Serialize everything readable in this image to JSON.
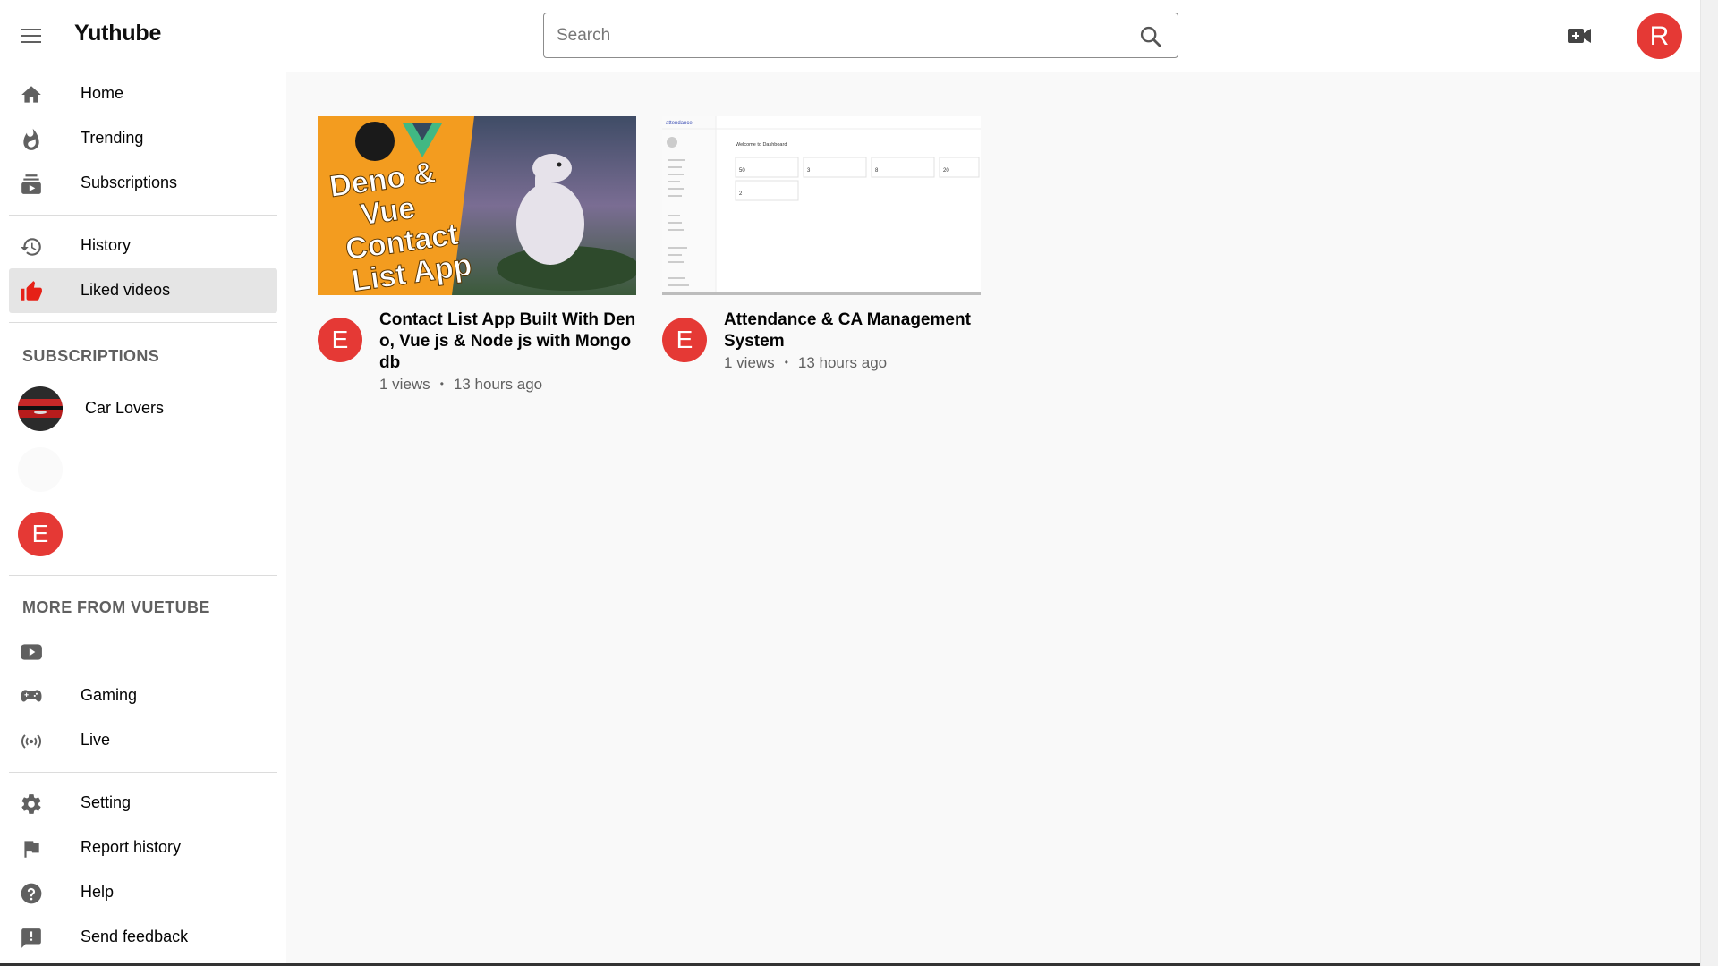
{
  "header": {
    "logo": "Yuthube",
    "search_placeholder": "Search",
    "avatar_letter": "R"
  },
  "sidebar": {
    "main": [
      {
        "label": "Home",
        "icon": "home-icon"
      },
      {
        "label": "Trending",
        "icon": "fire-icon"
      },
      {
        "label": "Subscriptions",
        "icon": "subscriptions-icon"
      }
    ],
    "library": [
      {
        "label": "History",
        "icon": "history-icon"
      },
      {
        "label": "Liked videos",
        "icon": "thumbs-up-icon",
        "active": true
      }
    ],
    "subscriptions_title": "SUBSCRIPTIONS",
    "subscriptions": [
      {
        "label": "Car Lovers"
      },
      {
        "label": ""
      },
      {
        "label": "",
        "letter": "E"
      }
    ],
    "more_title": "MORE FROM VUETUBE",
    "more": [
      {
        "label": "",
        "icon": "youtube-icon"
      },
      {
        "label": "Gaming",
        "icon": "gamepad-icon"
      },
      {
        "label": "Live",
        "icon": "live-icon"
      }
    ],
    "footer": [
      {
        "label": "Setting",
        "icon": "gear-icon"
      },
      {
        "label": "Report history",
        "icon": "flag-icon"
      },
      {
        "label": "Help",
        "icon": "help-icon"
      },
      {
        "label": "Send feedback",
        "icon": "feedback-icon"
      }
    ]
  },
  "videos": [
    {
      "title": "Contact List App Built With Deno, Vue js & Node js with Mongodb",
      "channel_letter": "E",
      "views": "1 views",
      "age": "13 hours ago",
      "thumb_text": [
        "Deno &",
        "Vue",
        "Contact",
        "List App"
      ]
    },
    {
      "title": "Attendance & CA Management System",
      "channel_letter": "E",
      "views": "1 views",
      "age": "13 hours ago",
      "thumb_text": [
        "attendance",
        "Welcome to Dashboard",
        "50",
        "3",
        "8",
        "20",
        "2"
      ]
    }
  ],
  "colors": {
    "accent": "#e53935",
    "sidebar_active": "#e5e5e5",
    "thumb_orange": "#f39c1f"
  }
}
